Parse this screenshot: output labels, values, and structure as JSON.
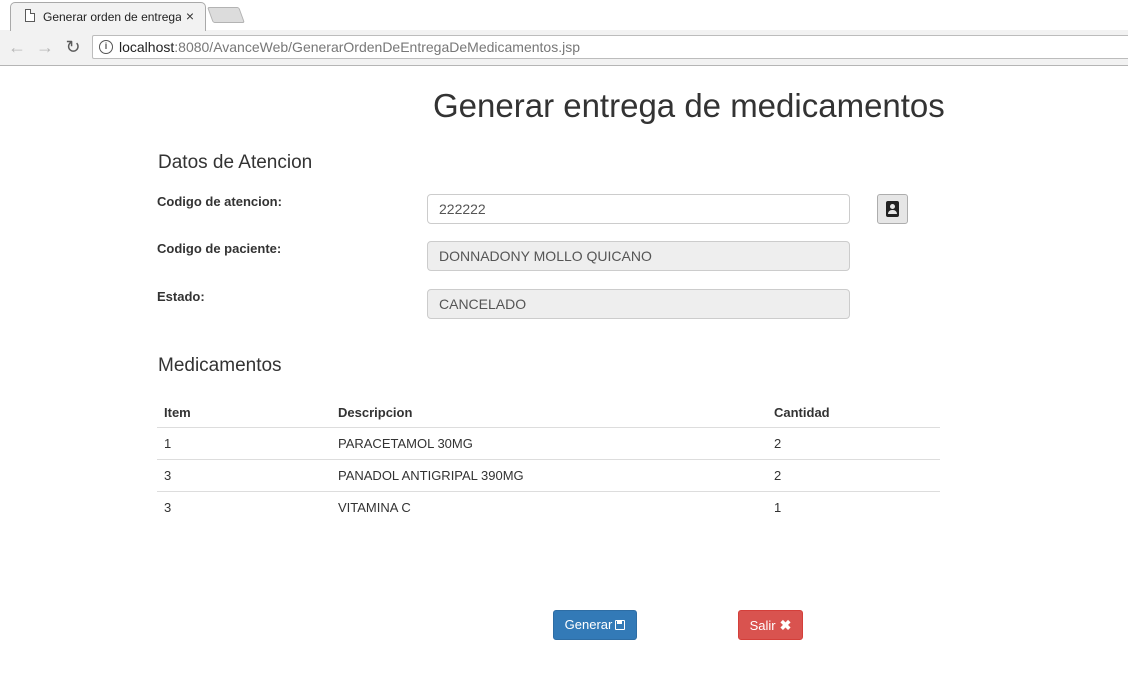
{
  "browser": {
    "tab_title": "Generar orden de entrega",
    "tab_close": "×",
    "url_host": "localhost",
    "url_rest": ":8080/AvanceWeb/GenerarOrdenDeEntregaDeMedicamentos.jsp"
  },
  "page": {
    "title": "Generar entrega de medicamentos"
  },
  "attention": {
    "section_title": "Datos de Atencion",
    "codigo_atencion_label": "Codigo de atencion:",
    "codigo_atencion_value": "222222",
    "codigo_paciente_label": "Codigo de paciente:",
    "codigo_paciente_value": "DONNADONY MOLLO QUICANO",
    "estado_label": "Estado:",
    "estado_value": "CANCELADO"
  },
  "medicamentos": {
    "section_title": "Medicamentos",
    "headers": [
      "Item",
      "Descripcion",
      "Cantidad"
    ],
    "rows": [
      [
        "1",
        "PARACETAMOL 30MG",
        "2"
      ],
      [
        "3",
        "PANADOL ANTIGRIPAL 390MG",
        "2"
      ],
      [
        "3",
        "VITAMINA C",
        "1"
      ]
    ]
  },
  "actions": {
    "generar_label": "Generar",
    "salir_label": "Salir",
    "close_glyph": "✖"
  },
  "colors": {
    "primary": "#337ab7",
    "danger": "#d9534f",
    "readonly_bg": "#eeeeee"
  },
  "icons": {
    "tab": "page-icon",
    "back": "back-arrow-icon",
    "forward": "forward-arrow-icon",
    "reload": "reload-icon",
    "info": "info-icon",
    "search": "contact-book-icon",
    "generar": "floppy-disk-icon",
    "salir": "close-icon"
  }
}
